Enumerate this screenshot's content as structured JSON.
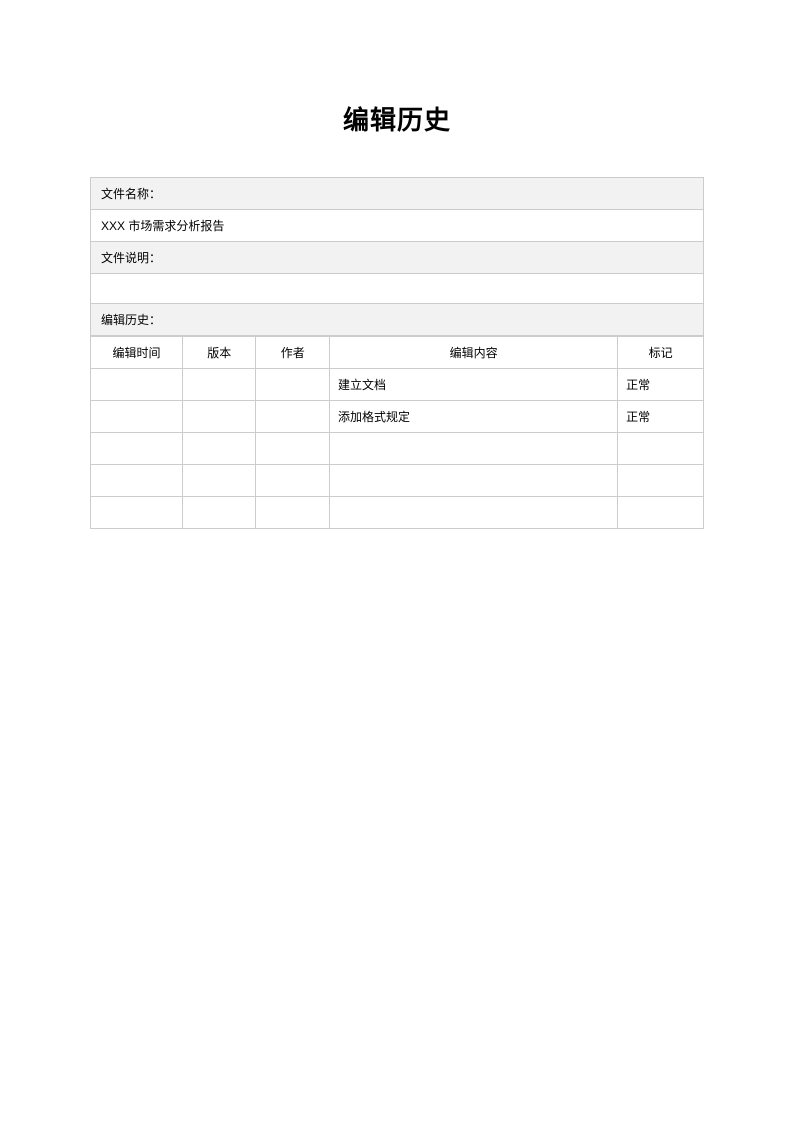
{
  "title": "编辑历史",
  "labels": {
    "filename": "文件名称：",
    "description": "文件说明：",
    "history": "编辑历史："
  },
  "filename_value": "XXX  市场需求分析报告",
  "description_value": "",
  "table": {
    "headers": {
      "time": "编辑时间",
      "version": "版本",
      "author": "作者",
      "content": "编辑内容",
      "mark": "标记"
    },
    "rows": [
      {
        "time": "",
        "version": "",
        "author": "",
        "content": "建立文档",
        "mark": "正常"
      },
      {
        "time": "",
        "version": "",
        "author": "",
        "content": "添加格式规定",
        "mark": "正常"
      },
      {
        "time": "",
        "version": "",
        "author": "",
        "content": "",
        "mark": ""
      },
      {
        "time": "",
        "version": "",
        "author": "",
        "content": "",
        "mark": ""
      },
      {
        "time": "",
        "version": "",
        "author": "",
        "content": "",
        "mark": ""
      }
    ]
  }
}
